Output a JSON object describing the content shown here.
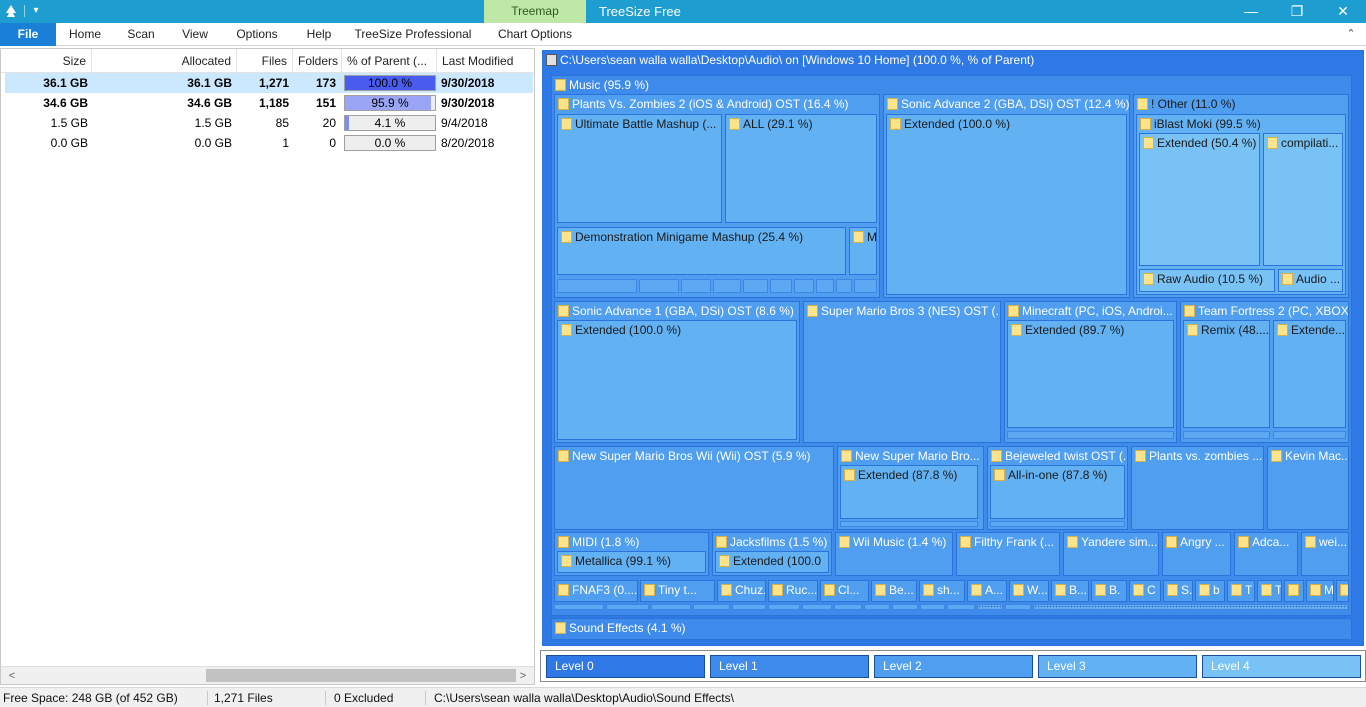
{
  "window": {
    "title": "TreeSize Free",
    "context_tab": "Treemap",
    "qa_dropdown": "▾",
    "buttons": {
      "minimize": "—",
      "restore": "❐",
      "close": "✕"
    }
  },
  "ribbon": {
    "tabs": [
      "File",
      "Home",
      "Scan",
      "View",
      "Options",
      "Help",
      "TreeSize Professional",
      "Chart Options"
    ],
    "collapse": "⌃"
  },
  "table": {
    "columns": [
      "Size",
      "Allocated",
      "Files",
      "Folders",
      "% of Parent (...",
      "Last Modified"
    ],
    "rows": [
      {
        "size": "36.1 GB",
        "allocated": "36.1 GB",
        "files": "1,271",
        "folders": "173",
        "percent_text": "100.0 %",
        "percent": 100.0,
        "modified": "9/30/2018",
        "bold": true,
        "selected": true
      },
      {
        "size": "34.6 GB",
        "allocated": "34.6 GB",
        "files": "1,185",
        "folders": "151",
        "percent_text": "95.9 %",
        "percent": 95.9,
        "modified": "9/30/2018",
        "bold": true,
        "selected": false
      },
      {
        "size": "1.5 GB",
        "allocated": "1.5 GB",
        "files": "85",
        "folders": "20",
        "percent_text": "4.1 %",
        "percent": 4.1,
        "modified": "9/4/2018",
        "bold": false,
        "selected": false
      },
      {
        "size": "0.0 GB",
        "allocated": "0.0 GB",
        "files": "1",
        "folders": "0",
        "percent_text": "0.0 %",
        "percent": 0.0,
        "modified": "8/20/2018",
        "bold": false,
        "selected": false
      }
    ],
    "scroll_left": "<",
    "scroll_right": ">"
  },
  "treemap": {
    "root": "C:\\Users\\sean walla walla\\Desktop\\Audio\\  on  [Windows 10 Home] (100.0 %, % of Parent)",
    "music": "Music (95.9 %)",
    "pvz": "Plants Vs. Zombies 2 (iOS & Android) OST (16.4 %)",
    "ubm": "Ultimate Battle Mashup (...",
    "all": "ALL (29.1 %)",
    "demo": "Demonstration Minigame Mashup (25.4 %)",
    "m": "M",
    "sa2": "Sonic Advance 2 (GBA, DSi) OST (12.4 %)",
    "sa2_ext": "Extended (100.0 %)",
    "other": "! Other (11.0 %)",
    "iblast": "iBlast Moki (99.5 %)",
    "iblast_ext": "Extended (50.4 %)",
    "compil": "compilati...",
    "raw": "Raw Audio (10.5 %)",
    "audio": "Audio ...",
    "sa1": "Sonic Advance 1 (GBA, DSi) OST (8.6 %)",
    "sa1_ext": "Extended (100.0 %)",
    "smb3": "Super Mario Bros 3 (NES) OST (...",
    "mc": "Minecraft (PC, iOS, Androi...",
    "mc_ext": "Extended (89.7 %)",
    "tf2": "Team Fortress 2 (PC, XBOX...",
    "remix": "Remix (48....",
    "tf2_ext": "Extende...",
    "nsmbw": "New Super Mario Bros Wii (Wii) OST (5.9 %)",
    "nsmb": "New Super Mario Bro...",
    "nsmb_ext": "Extended (87.8 %)",
    "bej": "Bejeweled twist OST (...",
    "bej_all": "All-in-one (87.8 %)",
    "pvz2": "Plants vs. zombies ...",
    "kevin": "Kevin Mac...",
    "midi": "MIDI (1.8 %)",
    "metallica": "Metallica (99.1 %)",
    "jacks": "Jacksfilms (1.5 %)",
    "jacks_ext": "Extended (100.0",
    "wii": "Wii Music (1.4 %)",
    "filthy": "Filthy Frank (...",
    "yandere": "Yandere sim...",
    "angry": "Angry ...",
    "adca": "Adca...",
    "wei": "wei...",
    "small": [
      "FNAF3 (0....",
      "Tiny t...",
      "Chuz...",
      "Ruc...",
      "Cl...",
      "Be...",
      "sh...",
      "A...",
      "W...",
      "B...",
      "B.",
      "C",
      "S.",
      "b",
      "T",
      "T",
      "",
      "M..",
      ""
    ],
    "sfx": "Sound Effects (4.1 %)"
  },
  "levels": {
    "labels": [
      "Level 0",
      "Level 1",
      "Level 2",
      "Level 3",
      "Level 4"
    ],
    "colors": [
      "#2f79e6",
      "#3e8bec",
      "#4f9ef0",
      "#62b1f3",
      "#78c2f6"
    ]
  },
  "status": {
    "free_space": "Free Space: 248 GB  (of 452 GB)",
    "files": "1,271  Files",
    "excluded": "0 Excluded",
    "path": "C:\\Users\\sean walla walla\\Desktop\\Audio\\Sound Effects\\"
  }
}
